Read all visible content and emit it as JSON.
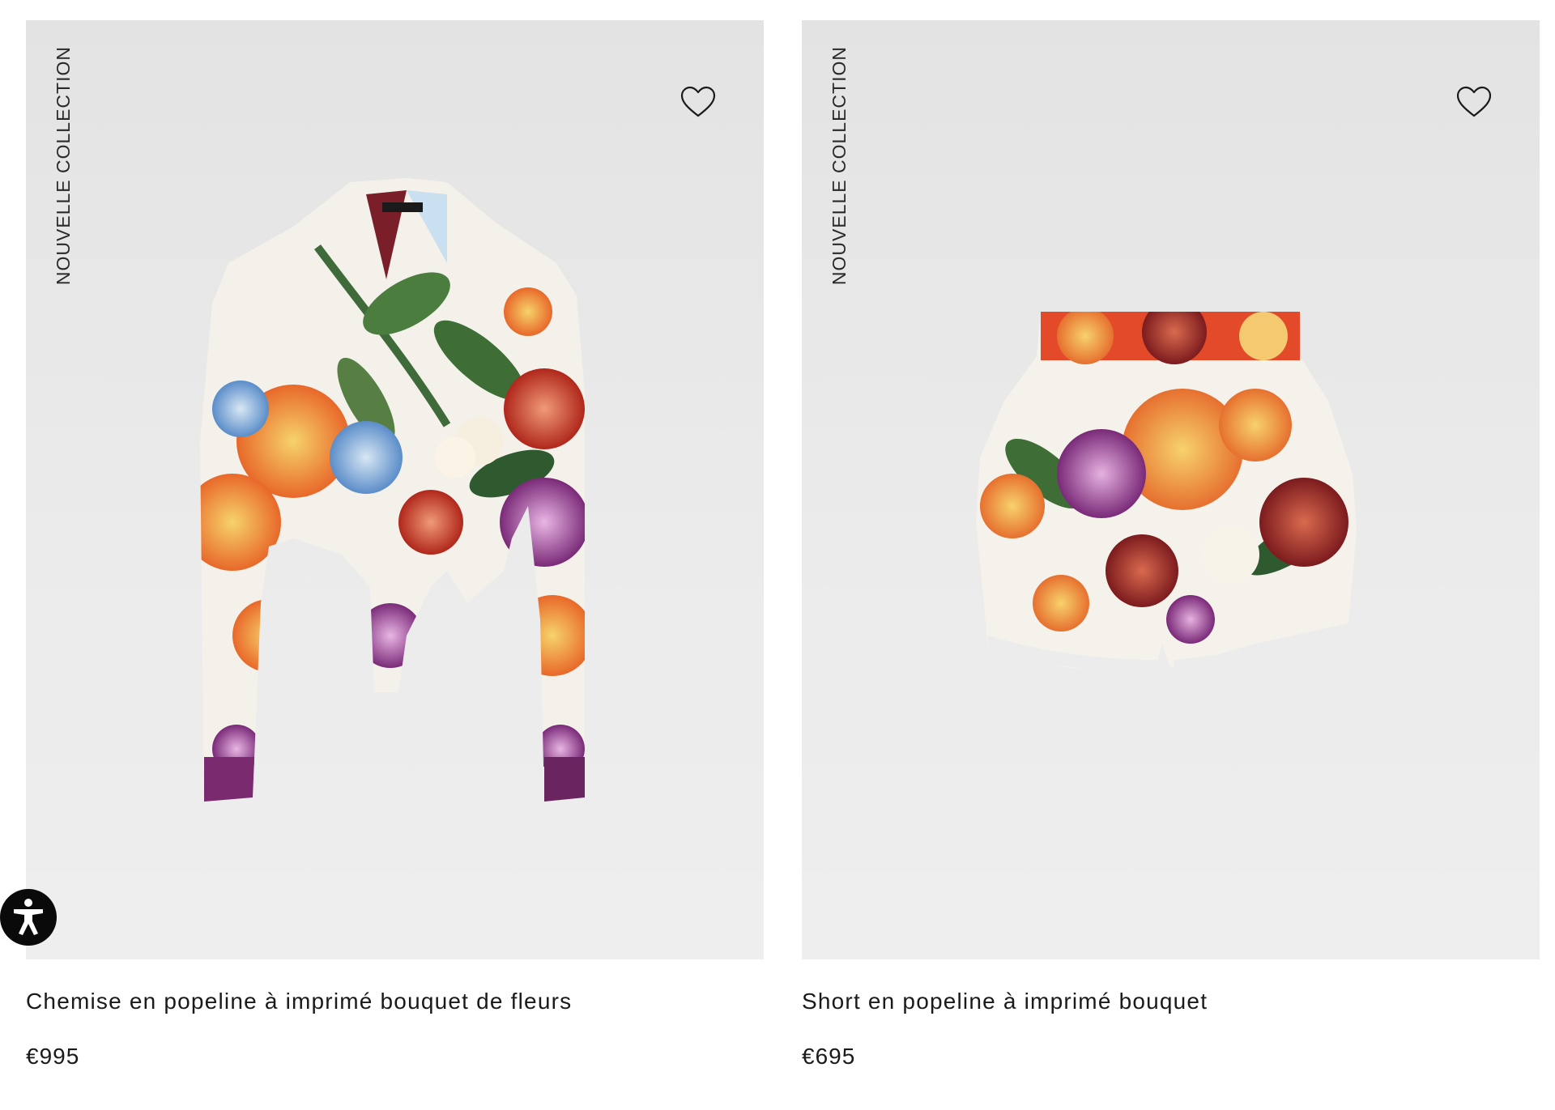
{
  "products": [
    {
      "badge": "NOUVELLE COLLECTION",
      "name": "Chemise en popeline à imprimé bouquet de fleurs",
      "price": "€995",
      "wishlist_icon": "heart-outline-icon",
      "image_desc_icon": "floral-shirt-illustration"
    },
    {
      "badge": "NOUVELLE COLLECTION",
      "name": "Short en popeline à imprimé bouquet",
      "price": "€695",
      "wishlist_icon": "heart-outline-icon",
      "image_desc_icon": "floral-shorts-illustration"
    }
  ],
  "accessibility": {
    "icon": "accessibility-person-icon"
  },
  "colors": {
    "image_bg": "#e8e8e8",
    "text": "#1a1a1a",
    "a11y_bg": "#0a0a0a"
  }
}
